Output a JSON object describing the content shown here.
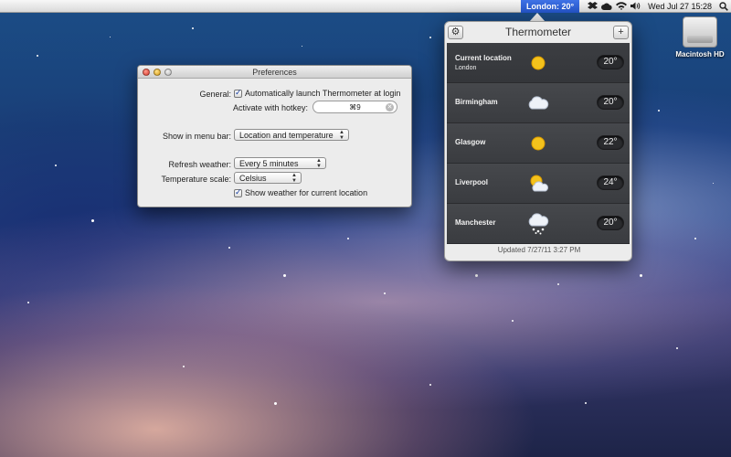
{
  "menubar": {
    "temperature_label": "London: 20°",
    "clock": "Wed Jul 27  15:28",
    "icons": [
      "dropbox-icon",
      "cloud-icon",
      "wifi-icon",
      "volume-icon",
      "spotlight-icon"
    ]
  },
  "desktop": {
    "disk_label": "Macintosh HD"
  },
  "preferences": {
    "title": "Preferences",
    "general_label": "General:",
    "auto_launch_label": "Automatically launch Thermometer at login",
    "auto_launch_checked": true,
    "hotkey_label": "Activate with hotkey:",
    "hotkey_value": "⌘9",
    "menu_bar_label": "Show in menu bar:",
    "menu_bar_value": "Location and temperature",
    "refresh_label": "Refresh weather:",
    "refresh_value": "Every 5 minutes",
    "scale_label": "Temperature scale:",
    "scale_value": "Celsius",
    "show_current_label": "Show weather for current location",
    "show_current_checked": true
  },
  "thermometer": {
    "title": "Thermometer",
    "rows": [
      {
        "city": "Current location",
        "sub": "London",
        "icon": "sun-icon",
        "temp": "20°"
      },
      {
        "city": "Birmingham",
        "icon": "cloud-icon",
        "temp": "20°"
      },
      {
        "city": "Glasgow",
        "icon": "sun-icon",
        "temp": "22°"
      },
      {
        "city": "Liverpool",
        "icon": "partly-cloudy-icon",
        "temp": "24°"
      },
      {
        "city": "Manchester",
        "icon": "snow-cloud-icon",
        "temp": "20°"
      }
    ],
    "updated": "Updated 7/27/11 3:27 PM"
  },
  "colors": {
    "menubar_highlight": "#2f63d8",
    "panel_dark": "#3a3c40"
  }
}
